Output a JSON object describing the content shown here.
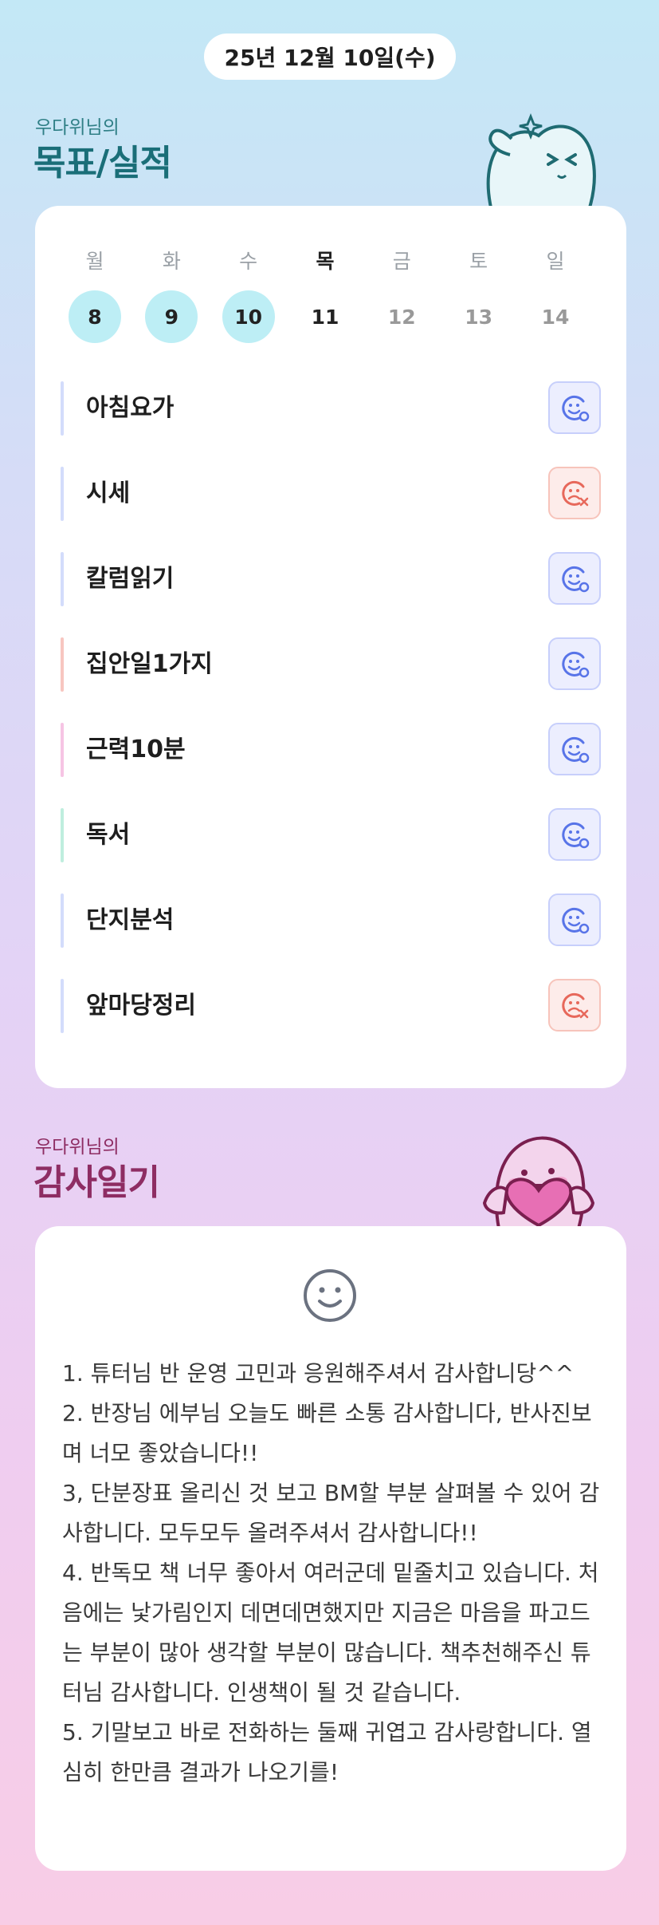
{
  "header": {
    "date": "25년 12월 10일(수)"
  },
  "goals_section": {
    "subtitle": "우다위님의",
    "title": "목표/실적"
  },
  "week": [
    {
      "name": "월",
      "num": "8",
      "state": "done"
    },
    {
      "name": "화",
      "num": "9",
      "state": "done"
    },
    {
      "name": "수",
      "num": "10",
      "state": "done"
    },
    {
      "name": "목",
      "num": "11",
      "state": "today"
    },
    {
      "name": "금",
      "num": "12",
      "state": "future"
    },
    {
      "name": "토",
      "num": "13",
      "state": "future"
    },
    {
      "name": "일",
      "num": "14",
      "state": "future"
    }
  ],
  "goals": [
    {
      "label": "아침요가",
      "status": "success",
      "bar_color": "#d3dcfb"
    },
    {
      "label": "시세",
      "status": "fail",
      "bar_color": "#d3dcfb"
    },
    {
      "label": "칼럼읽기",
      "status": "success",
      "bar_color": "#d3dcfb"
    },
    {
      "label": "집안일1가지",
      "status": "success",
      "bar_color": "#f7c6c0"
    },
    {
      "label": "근력10분",
      "status": "success",
      "bar_color": "#f6c4e4"
    },
    {
      "label": "독서",
      "status": "success",
      "bar_color": "#bfeede"
    },
    {
      "label": "단지분석",
      "status": "success",
      "bar_color": "#d3dcfb"
    },
    {
      "label": "앞마당정리",
      "status": "fail",
      "bar_color": "#d3dcfb"
    }
  ],
  "colors": {
    "goals_title": "#1a6e78",
    "diary_title": "#8e2d63",
    "success": "#5874e8",
    "fail": "#e7685b"
  },
  "diary_section": {
    "subtitle": "우다위님의",
    "title": "감사일기"
  },
  "diary": {
    "icon": "smile-icon",
    "text": "1. 튜터님 반 운영 고민과 응원해주셔서 감사합니당^^\n2. 반장님 에부님 오늘도 빠른 소통 감사합니다, 반사진보며 너모 좋았습니다!!\n3, 단분장표 올리신 것 보고 BM할 부분 살펴볼 수 있어 감사합니다. 모두모두 올려주셔서 감사합니다!!\n4. 반독모 책 너무 좋아서 여러군데 밑줄치고 있습니다. 처음에는 낯가림인지 데면데면했지만 지금은 마음을 파고드는 부분이 많아 생각할 부분이 많습니다. 책추천해주신 튜터님 감사합니다. 인생책이 될 것 같습니다.\n5. 기말보고 바로 전화하는 둘째 귀엽고 감사랑합니다. 열심히 한만큼 결과가 나오기를!"
  }
}
